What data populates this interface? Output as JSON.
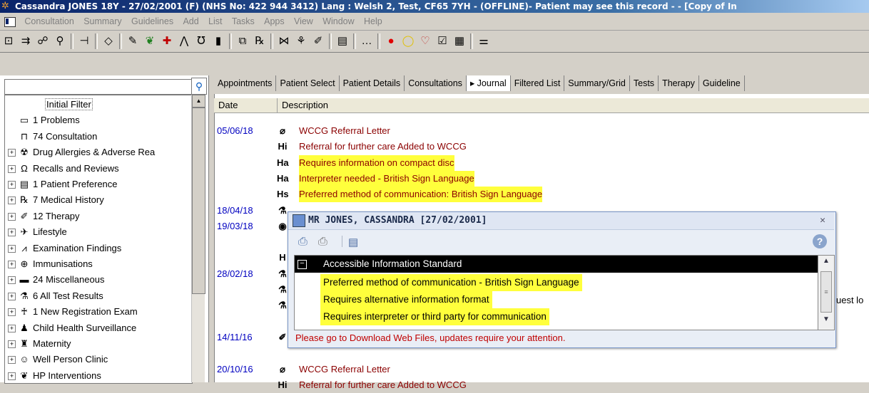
{
  "window": {
    "title": "Cassandra JONES 18Y - 27/02/2001 (F) (NHS No: 422 944 3412) Lang : Welsh  2, Test, CF65 7YH - (OFFLINE)- Patient may see this record - - [Copy of In"
  },
  "menu": [
    "Consultation",
    "Summary",
    "Guidelines",
    "Add",
    "List",
    "Tasks",
    "Apps",
    "View",
    "Window",
    "Help"
  ],
  "toolbar": {
    "icons": [
      "consultation-icon",
      "people-icon",
      "group-icon",
      "search-person-icon",
      "tree-icon",
      "flag-icon",
      "notebook-icon",
      "apple-icon",
      "medical-cross-icon",
      "figure-icon",
      "stethoscope-icon",
      "book-icon",
      "copy-icon",
      "prescription-icon",
      "bowtie-icon",
      "bulb-icon",
      "pen-icon",
      "document-icon",
      "more-icon",
      "record-icon",
      "speech-bubble-icon",
      "heart-icon",
      "checklist-icon",
      "calendar-icon",
      "list-icon"
    ],
    "glyphs": [
      "⊡",
      "⇉",
      "☍",
      "⚲",
      "⊣",
      "◇",
      "✎",
      "❦",
      "✚",
      "⋀",
      "℧",
      "▮",
      "⧉",
      "℞",
      "⋈",
      "⚘",
      "✐",
      "▤",
      "…",
      "●",
      "◯",
      "♡",
      "☑",
      "▦",
      "⚌"
    ]
  },
  "tree": {
    "search_value": "",
    "items": [
      {
        "label": "Initial Filter",
        "icon": "",
        "expand": false
      },
      {
        "label": "1 Problems",
        "icon": "problems-icon",
        "glyph": "▭",
        "expand": false
      },
      {
        "label": "74 Consultation",
        "icon": "consultation-icon",
        "glyph": "⊓",
        "expand": false
      },
      {
        "label": "Drug Allergies & Adverse Rea",
        "icon": "allergy-icon",
        "glyph": "☢",
        "expand": true
      },
      {
        "label": "Recalls and Reviews",
        "icon": "recall-icon",
        "glyph": "Ω",
        "expand": true
      },
      {
        "label": "1 Patient Preference",
        "icon": "preference-icon",
        "glyph": "▤",
        "expand": true
      },
      {
        "label": "7 Medical History",
        "icon": "prescription-icon",
        "glyph": "℞",
        "expand": true
      },
      {
        "label": "12 Therapy",
        "icon": "pen-icon",
        "glyph": "✐",
        "expand": true
      },
      {
        "label": "Lifestyle",
        "icon": "lifestyle-icon",
        "glyph": "✈",
        "expand": true
      },
      {
        "label": "Examination Findings",
        "icon": "chart-icon",
        "glyph": "⩘",
        "expand": true
      },
      {
        "label": "Immunisations",
        "icon": "immunisation-icon",
        "glyph": "⊕",
        "expand": true
      },
      {
        "label": "24 Miscellaneous",
        "icon": "folder-icon",
        "glyph": "▬",
        "expand": true
      },
      {
        "label": "6 All Test Results",
        "icon": "test-icon",
        "glyph": "⚗",
        "expand": true
      },
      {
        "label": "1 New Registration Exam",
        "icon": "person-icon",
        "glyph": "♰",
        "expand": true
      },
      {
        "label": "Child Health Surveillance",
        "icon": "child-icon",
        "glyph": "♟",
        "expand": true
      },
      {
        "label": "Maternity",
        "icon": "pram-icon",
        "glyph": "♜",
        "expand": true
      },
      {
        "label": "Well Person Clinic",
        "icon": "smiley-icon",
        "glyph": "☺",
        "expand": true
      },
      {
        "label": "HP Interventions",
        "icon": "apple-icon",
        "glyph": "❦",
        "expand": true
      }
    ]
  },
  "tabs": [
    {
      "label": "Appointments",
      "active": false
    },
    {
      "label": "Patient Select",
      "active": false
    },
    {
      "label": "Patient Details",
      "active": false
    },
    {
      "label": "Consultations",
      "active": false
    },
    {
      "label": "▸ Journal",
      "active": true
    },
    {
      "label": "Filtered List",
      "active": false
    },
    {
      "label": "Summary/Grid",
      "active": false
    },
    {
      "label": "Tests",
      "active": false
    },
    {
      "label": "Therapy",
      "active": false
    },
    {
      "label": "Guideline",
      "active": false
    }
  ],
  "journal": {
    "columns": [
      "Date",
      "Description"
    ],
    "rows": [
      {
        "date": "05/06/18",
        "icon": "paperclip-icon",
        "glyph": "⌀",
        "desc": "WCCG Referral Letter",
        "highlight": false
      },
      {
        "date": "",
        "icon": "referral-icon",
        "glyph": "Hi",
        "desc": "Referral for further care Added to WCCG",
        "highlight": false
      },
      {
        "date": "",
        "icon": "alert-a-icon",
        "glyph": "Ha",
        "desc": "Requires information on compact disc",
        "highlight": true
      },
      {
        "date": "",
        "icon": "alert-a-icon",
        "glyph": "Ha",
        "desc": "Interpreter needed - British Sign Language",
        "highlight": true
      },
      {
        "date": "",
        "icon": "alert-s-icon",
        "glyph": "Hs",
        "desc": "Preferred method of communication: British Sign Language",
        "highlight": true
      },
      {
        "date": "18/04/18",
        "icon": "test-icon",
        "glyph": "⚗",
        "desc": "",
        "highlight": false
      },
      {
        "date": "19/03/18",
        "icon": "globe-icon",
        "glyph": "◉",
        "desc": "",
        "highlight": false
      },
      {
        "date": "",
        "icon": "",
        "glyph": "",
        "desc": "",
        "highlight": false
      },
      {
        "date": "",
        "icon": "",
        "glyph": "H",
        "desc": "",
        "highlight": false
      },
      {
        "date": "28/02/18",
        "icon": "test-icon",
        "glyph": "⚗",
        "desc": "",
        "highlight": false
      },
      {
        "date": "",
        "icon": "test-icon",
        "glyph": "⚗",
        "desc": "",
        "highlight": false
      },
      {
        "date": "",
        "icon": "test-icon",
        "glyph": "⚗",
        "desc": "",
        "highlight": false
      },
      {
        "date": "",
        "icon": "",
        "glyph": "",
        "desc": "",
        "highlight": false
      },
      {
        "date": "14/11/16",
        "icon": "pen-icon",
        "glyph": "✐",
        "desc": "",
        "highlight": false
      },
      {
        "date": "",
        "icon": "",
        "glyph": "",
        "desc": "",
        "highlight": false
      },
      {
        "date": "20/10/16",
        "icon": "paperclip-icon",
        "glyph": "⌀",
        "desc": "WCCG Referral Letter",
        "highlight": false
      },
      {
        "date": "",
        "icon": "referral-icon",
        "glyph": "Hi",
        "desc": "Referral for further care Added to WCCG",
        "highlight": false
      }
    ],
    "truncated_right": "uest lo"
  },
  "popup": {
    "title": "MR JONES, CASSANDRA [27/02/2001]",
    "header": "Accessible Information Standard",
    "items": [
      "Preferred method of communication - British Sign Language",
      "Requires alternative information format",
      "Requires interpreter or third party for communication"
    ],
    "message": "Please go to Download Web Files, updates require your attention."
  },
  "colors": {
    "highlight": "#ffff3c",
    "journal_text": "#8b0000",
    "date_text": "#0000c0",
    "message_text": "#c00000"
  }
}
